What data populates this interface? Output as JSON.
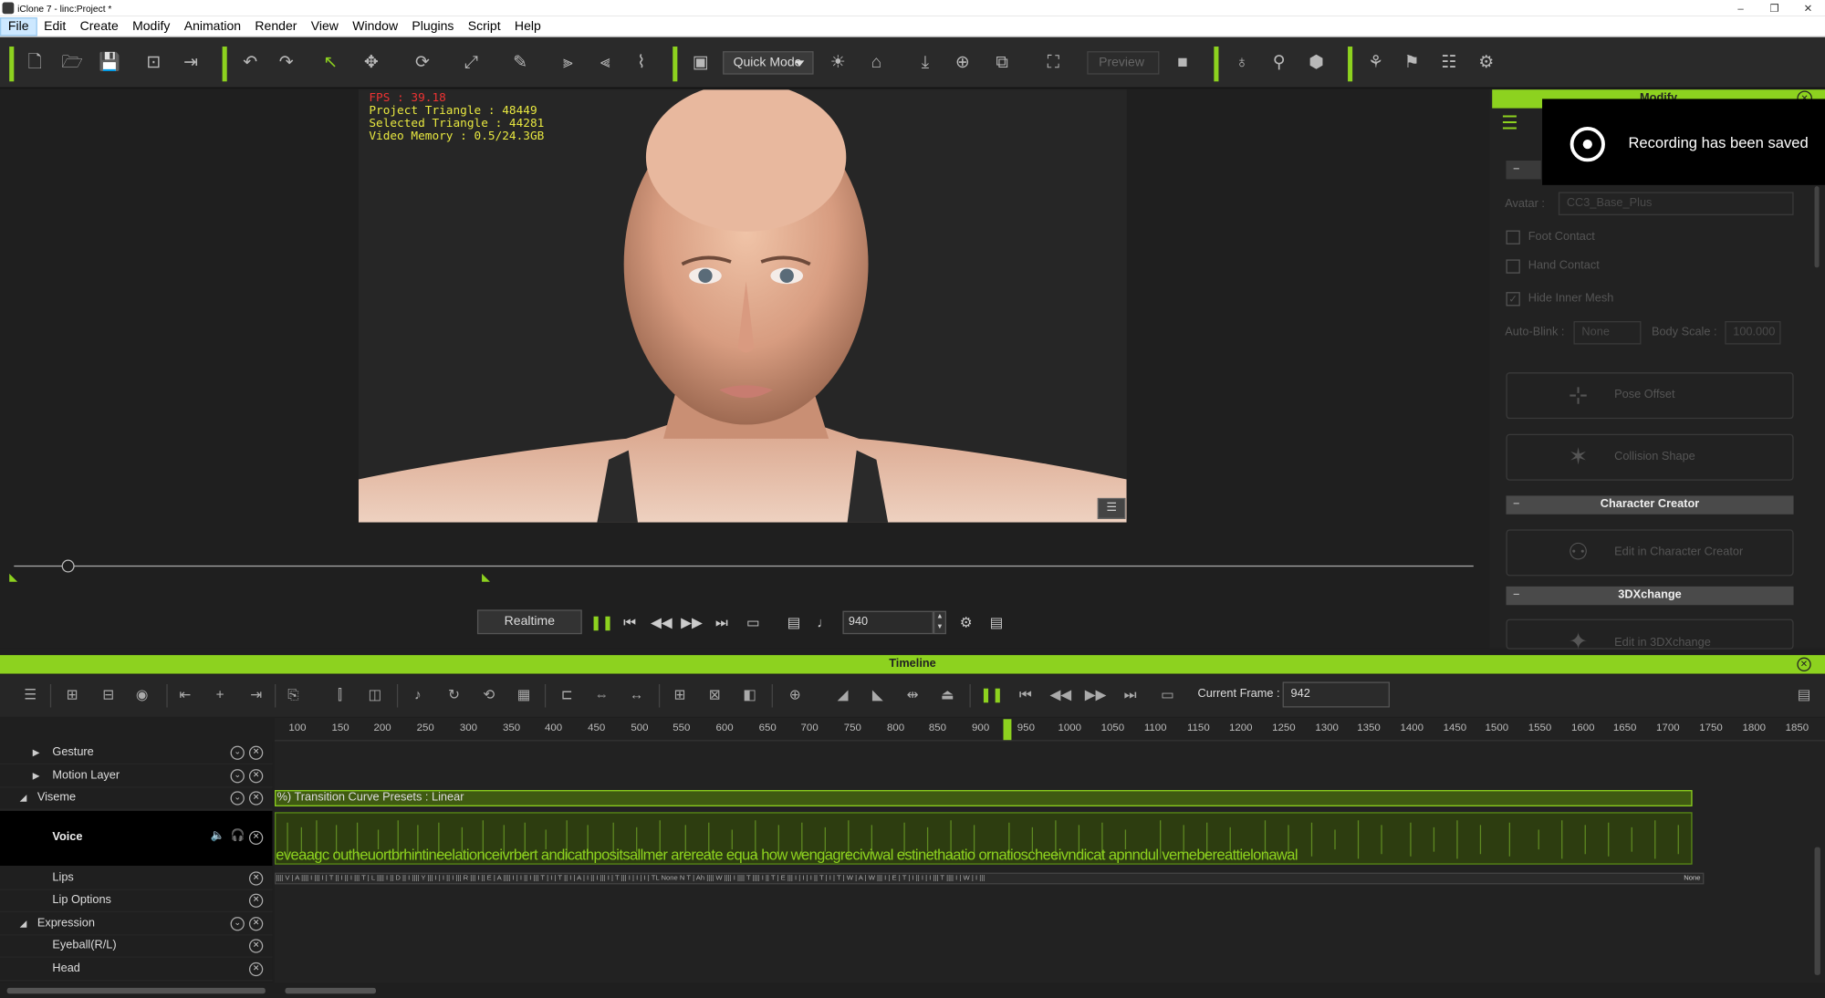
{
  "window": {
    "title": "iClone 7 - linc:Project *",
    "controls": [
      "–",
      "❐",
      "✕"
    ]
  },
  "menu": [
    "File",
    "Edit",
    "Create",
    "Modify",
    "Animation",
    "Render",
    "View",
    "Window",
    "Plugins",
    "Script",
    "Help"
  ],
  "toolbar": {
    "quick_mode": "Quick Mode",
    "preview": "Preview"
  },
  "viewport": {
    "fps": "FPS : 39.18",
    "project_triangle": "Project Triangle : 48449",
    "selected_triangle": "Selected Triangle : 44281",
    "video_memory": "Video Memory : 0.5/24.3GB"
  },
  "playback": {
    "realtime": "Realtime",
    "frame": "940"
  },
  "modify_panel": {
    "title": "Modify",
    "avatar_label": "Avatar :",
    "avatar_value": "CC3_Base_Plus",
    "foot_contact": "Foot Contact",
    "hand_contact": "Hand Contact",
    "hide_inner_mesh": "Hide Inner Mesh",
    "auto_blink_label": "Auto-Blink :",
    "auto_blink_value": "None",
    "body_scale_label": "Body Scale :",
    "body_scale_value": "100.000",
    "pose_offset": "Pose Offset",
    "collision_shape": "Collision Shape",
    "character_creator_section": "Character Creator",
    "edit_in_cc": "Edit in Character Creator",
    "threedx_section": "3DXchange",
    "edit_in_3dx": "Edit in 3DXchange"
  },
  "toast": {
    "message": "Recording has been saved"
  },
  "timeline": {
    "title": "Timeline",
    "current_frame_label": "Current Frame :",
    "current_frame": "942",
    "ruler": [
      "100",
      "150",
      "200",
      "250",
      "300",
      "350",
      "400",
      "450",
      "500",
      "550",
      "600",
      "650",
      "700",
      "750",
      "800",
      "850",
      "900",
      "950",
      "1000",
      "1050",
      "1100",
      "1150",
      "1200",
      "1250",
      "1300",
      "1350",
      "1400",
      "1450",
      "1500",
      "1550",
      "1600",
      "1650",
      "1700",
      "1750",
      "1800",
      "1850"
    ],
    "tracks": {
      "gesture": "Gesture",
      "motion_layer": "Motion Layer",
      "viseme": "Viseme",
      "voice": "Voice",
      "lips": "Lips",
      "lip_options": "Lip Options",
      "expression": "Expression",
      "eyeball": "Eyeball(R/L)",
      "head": "Head"
    },
    "transition_clip": "%) Transition Curve Presets : Linear",
    "voice_text": "eveaagc  outheuortbrhintineelationceivrbert   andicathpositsallmer arereate equa     how  wengagreciviwal  estinethaatio ornatioscheeivndicat apnndul   vemebereattielonawal",
    "lips_strip": "|||| V | A |||| I ||| I | T || I || I ||| T | L |||| I || D || I |||| Y ||| I | I || I ||| R ||| I || E | A |||| I | I || I ||| T | I | T || I | A | I || I ||| I | T ||| I | I | I | TL None N T | Ah |||| W |||| I |||| T |||| I || T | E ||| I | I | I || T | I | T | W | A | W ||| I | E | T | I || I | I ||| T |||| I | W | I |||",
    "lips_none": "None"
  }
}
